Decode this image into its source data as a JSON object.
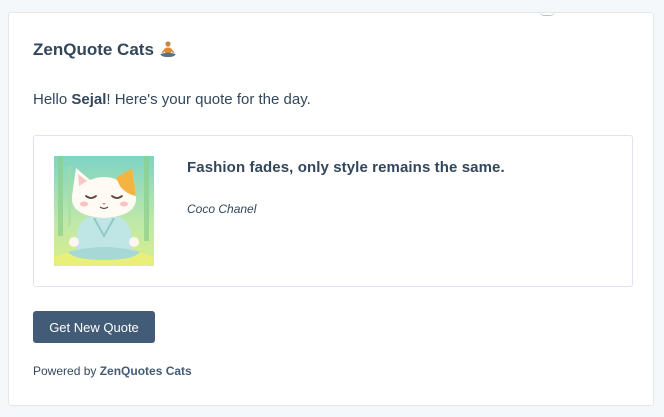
{
  "app": {
    "title": "ZenQuote Cats",
    "title_icon": "meditating-person-icon"
  },
  "greeting": {
    "prefix": "Hello ",
    "name": "Sejal",
    "suffix": "! Here's your quote for the day."
  },
  "quote": {
    "image_icon": "meditating-cat-illustration",
    "text": "Fashion fades, only style remains the same.",
    "author": "Coco Chanel"
  },
  "actions": {
    "new_quote_label": "Get New Quote"
  },
  "footer": {
    "prefix": "Powered by ",
    "brand": "ZenQuotes Cats"
  },
  "colors": {
    "page_bg": "#f5f8fa",
    "text": "#33475b",
    "button_bg": "#425b76",
    "border": "#dfe3eb"
  }
}
